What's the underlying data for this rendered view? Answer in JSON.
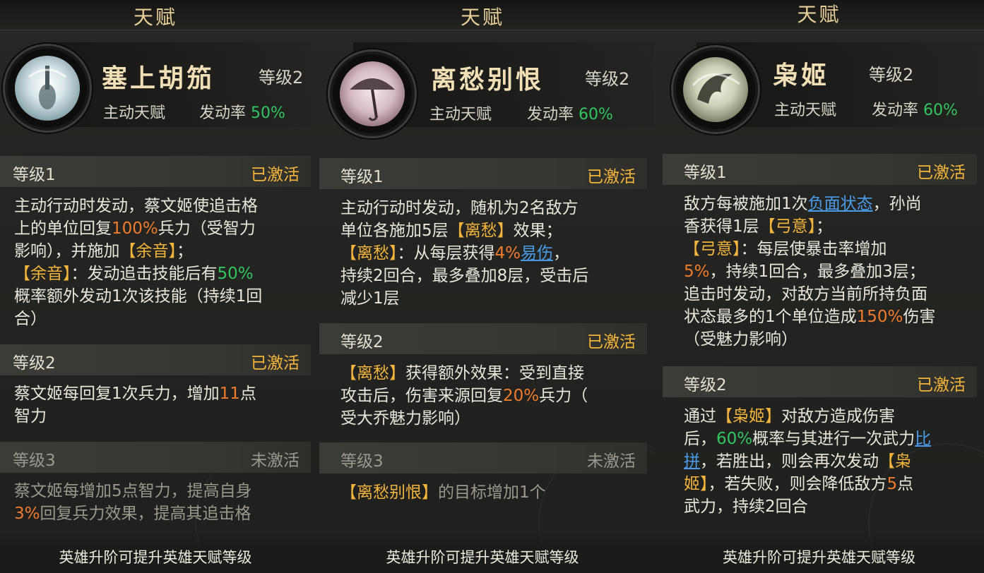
{
  "panels": [
    {
      "header_title": "天赋",
      "name": "塞上胡笳",
      "level": "等级2",
      "type": "主动天赋",
      "rate_label": "发动率",
      "rate_value": "50%",
      "icon": "pipa-lute-icon",
      "sections": [
        {
          "level": "等级1",
          "status": "已激活",
          "lines": [
            [
              [
                "主动行动时发动，蔡文姬使追击格",
                ""
              ]
            ],
            [
              [
                "上的单位回复",
                ""
              ],
              [
                "100%",
                "o"
              ],
              [
                "兵力（受智力",
                ""
              ]
            ],
            [
              [
                "影响），并施加",
                ""
              ],
              [
                "【余音】",
                "y"
              ],
              [
                "；",
                ""
              ]
            ],
            [
              [
                "【余音】",
                "y"
              ],
              [
                "：发动追击技能后有",
                ""
              ],
              [
                "50%",
                "g"
              ]
            ],
            [
              [
                "概率额外发动1次该技能（持续1回",
                ""
              ]
            ],
            [
              [
                "合）",
                ""
              ]
            ]
          ]
        },
        {
          "level": "等级2",
          "status": "已激活",
          "lines": [
            [
              [
                "蔡文姬每回复1次兵力，增加",
                ""
              ],
              [
                "11",
                "o"
              ],
              [
                "点",
                ""
              ]
            ],
            [
              [
                "智力",
                ""
              ]
            ]
          ]
        },
        {
          "level": "等级3",
          "status": "未激活",
          "lines": [
            [
              [
                "蔡文姬每增加5点智力，提高自身",
                ""
              ]
            ],
            [
              [
                "3%",
                "o"
              ],
              [
                "回复兵力效果，提高其追击格",
                ""
              ]
            ]
          ]
        }
      ],
      "footer": "英雄升阶可提升英雄天赋等级"
    },
    {
      "header_title": "天赋",
      "name": "离愁别恨",
      "level": "等级2",
      "type": "主动天赋",
      "rate_label": "发动率",
      "rate_value": "60%",
      "icon": "umbrella-icon",
      "sections": [
        {
          "level": "等级1",
          "status": "已激活",
          "lines": [
            [
              [
                "主动行动时发动，随机为2名敌方",
                ""
              ]
            ],
            [
              [
                "单位各施加5层",
                ""
              ],
              [
                "【离愁】",
                "y"
              ],
              [
                "效果；",
                ""
              ]
            ],
            [
              [
                "【离愁】",
                "y"
              ],
              [
                "：从每层获得",
                ""
              ],
              [
                "4%",
                "o"
              ],
              [
                "易伤",
                "b"
              ],
              [
                "，",
                ""
              ]
            ],
            [
              [
                "持续2回合，最多叠加8层，受击后",
                ""
              ]
            ],
            [
              [
                "减少1层",
                ""
              ]
            ]
          ]
        },
        {
          "level": "等级2",
          "status": "已激活",
          "lines": [
            [
              [
                "【离愁】",
                "y"
              ],
              [
                "获得额外效果：受到直接",
                ""
              ]
            ],
            [
              [
                "攻击后，伤害来源回复",
                ""
              ],
              [
                "20%",
                "o"
              ],
              [
                "兵力（",
                ""
              ]
            ],
            [
              [
                "受大乔魅力影响）",
                ""
              ]
            ]
          ]
        },
        {
          "level": "等级3",
          "status": "未激活",
          "lines": [
            [
              [
                "【离愁别恨】",
                "y"
              ],
              [
                "的目标增加1个",
                ""
              ]
            ]
          ]
        }
      ],
      "footer": "英雄升阶可提升英雄天赋等级"
    },
    {
      "header_title": "天赋",
      "name": "枭姬",
      "level": "等级2",
      "type": "主动天赋",
      "rate_label": "发动率",
      "rate_value": "60%",
      "icon": "bird-swirl-icon",
      "sections": [
        {
          "level": "等级1",
          "status": "已激活",
          "lines": [
            [
              [
                "敌方每被施加1次",
                ""
              ],
              [
                "负面状态",
                "b"
              ],
              [
                "，孙尚",
                ""
              ]
            ],
            [
              [
                "香获得1层",
                ""
              ],
              [
                "【弓意】",
                "y"
              ],
              [
                "；",
                ""
              ]
            ],
            [
              [
                "【弓意】",
                "y"
              ],
              [
                "：每层使暴击率增加",
                ""
              ]
            ],
            [
              [
                "5%",
                "o"
              ],
              [
                "，持续1回合，最多叠加3层；",
                ""
              ]
            ],
            [
              [
                "追击时发动，对敌方当前所持负面",
                ""
              ]
            ],
            [
              [
                "状态最多的1个单位造成",
                ""
              ],
              [
                "150%",
                "o"
              ],
              [
                "伤害",
                ""
              ]
            ],
            [
              [
                "（受魅力影响）",
                ""
              ]
            ]
          ]
        },
        {
          "level": "等级2",
          "status": "已激活",
          "lines": [
            [
              [
                "通过",
                ""
              ],
              [
                "【枭姬】",
                "y"
              ],
              [
                "对敌方造成伤害",
                ""
              ]
            ],
            [
              [
                "后，",
                ""
              ],
              [
                "60%",
                "g"
              ],
              [
                "概率与其进行一次武力",
                ""
              ],
              [
                "比",
                "b"
              ]
            ],
            [
              [
                "拼",
                "b"
              ],
              [
                "，若胜出，则会再次发动",
                ""
              ],
              [
                "【枭",
                "y"
              ]
            ],
            [
              [
                "姬】",
                "y"
              ],
              [
                "，若失败，则会降低敌方",
                ""
              ],
              [
                "5",
                "o"
              ],
              [
                "点",
                ""
              ]
            ],
            [
              [
                "武力，持续2回合",
                ""
              ]
            ]
          ]
        }
      ],
      "footer": "英雄升阶可提升英雄天赋等级"
    }
  ]
}
